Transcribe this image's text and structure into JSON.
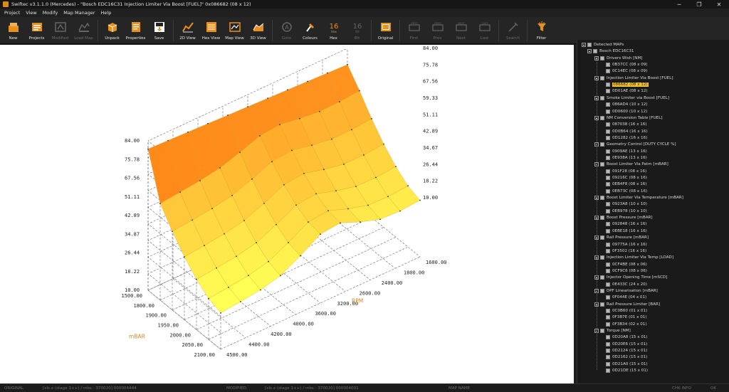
{
  "window": {
    "title": "Swiftec v3.1.1.0 (Mercedes) - \"Bosch EDC16C31 Injection Limiter Via Boost [FUEL]\" 0x086682 (08 x 12)",
    "minimize": "─",
    "maximize": "❐",
    "close": "✕"
  },
  "menu": [
    "Project",
    "View",
    "Modify",
    "Map Manager",
    "Help"
  ],
  "toolbar": [
    {
      "label": "New",
      "icon": "new-icon",
      "enabled": true
    },
    {
      "label": "Projects",
      "icon": "projects-icon",
      "enabled": true
    },
    {
      "label": "Modified",
      "icon": "modified-icon",
      "enabled": false
    },
    {
      "label": "Load Map",
      "icon": "load-map-icon",
      "enabled": false
    },
    {
      "label": "Unpack",
      "icon": "unpack-icon",
      "enabled": true
    },
    {
      "label": "Properties",
      "icon": "properties-icon",
      "enabled": true
    },
    {
      "label": "Save",
      "icon": "save-icon",
      "enabled": true
    },
    {
      "label": "2D View",
      "icon": "2d-view-icon",
      "enabled": true
    },
    {
      "label": "Hex View",
      "icon": "hex-view-icon",
      "enabled": true
    },
    {
      "label": "Map View",
      "icon": "map-view-icon",
      "enabled": true
    },
    {
      "label": "3D View",
      "icon": "3d-view-icon",
      "enabled": true
    },
    {
      "label": "Goto",
      "icon": "goto-icon",
      "enabled": false
    },
    {
      "label": "Colours",
      "icon": "colours-icon",
      "enabled": true
    },
    {
      "label": "Hex",
      "icon": "hex-icon",
      "enabled": true,
      "badge": "16"
    },
    {
      "label": "Bit",
      "icon": "bit-icon",
      "enabled": false,
      "badge": "16"
    },
    {
      "label": "Original",
      "icon": "original-icon",
      "enabled": true
    },
    {
      "label": "First",
      "icon": "first-icon",
      "enabled": false
    },
    {
      "label": "Prev",
      "icon": "prev-icon",
      "enabled": false
    },
    {
      "label": "Next",
      "icon": "next-icon",
      "enabled": false
    },
    {
      "label": "Last",
      "icon": "last-icon",
      "enabled": false
    },
    {
      "label": "Search",
      "icon": "search-icon",
      "enabled": false
    },
    {
      "label": "Filter",
      "icon": "filter-icon",
      "enabled": true
    }
  ],
  "colors": {
    "accent": "#e8901c",
    "surface_light": "#ffff55",
    "surface_dark": "#ff8a1a",
    "selected": "#f4c430"
  },
  "chart_data": {
    "type": "surface3d",
    "z_ticks": [
      "84.00",
      "75.78",
      "67.56",
      "59.33",
      "51.11",
      "42.89",
      "34.67",
      "26.44",
      "18.22",
      "10.00"
    ],
    "z_ticks_left": [
      "84.00",
      "75.78",
      "67.56",
      "51.11",
      "42.89",
      "34.87",
      "26.44",
      "18.22",
      "10.00"
    ],
    "x_axis": {
      "label": "RPM",
      "ticks": [
        "1600.00",
        "1800.00",
        "2400.00",
        "2600.00",
        "3200.00",
        "3600.00",
        "4000.00",
        "4200.00",
        "4400.00",
        "4500.00"
      ]
    },
    "y_axis": {
      "label": "mBAR",
      "ticks": [
        "1500.00",
        "1800.00",
        "1900.00",
        "1950.00",
        "2000.00",
        "2050.00",
        "2100.00"
      ]
    },
    "zlim": [
      10,
      84
    ]
  },
  "tree": {
    "root": "Detected MAPs",
    "ecu": "Bosch EDC16C31",
    "groups": [
      {
        "name": "Drivers Wish [NM]",
        "items": [
          "0B37CC (08 x 09)",
          "0C14EC (08 x 09)"
        ]
      },
      {
        "name": "Injection Limiter Via Boost [FUEL]",
        "items": [
          "086682 (08 x 12)",
          "0D01AE (08 x 12)"
        ],
        "selected": 0
      },
      {
        "name": "Smoke Limiter via Boost [FUEL]",
        "items": [
          "086AD4 (10 x 12)",
          "0D0600 (10 x 12)"
        ]
      },
      {
        "name": "NM Conversion Table [FUEL]",
        "items": [
          "087038 (16 x 16)",
          "0D0B64 (16 x 16)",
          "0D1282 (16 x 16)"
        ]
      },
      {
        "name": "Geometry Control [DUTY CYCLE %]",
        "items": [
          "0909AE (13 x 16)",
          "0E938A (13 x 16)"
        ]
      },
      {
        "name": "Boost Limiter Via Patm [mBAR]",
        "items": [
          "091F28 (08 x 16)",
          "09216C (08 x 16)",
          "0EB4F8 (08 x 16)",
          "0EB73C (08 x 16)"
        ]
      },
      {
        "name": "Boost Limiter Via Temperature [mBAR]",
        "items": [
          "0923A8 (10 x 10)",
          "0EB978 (10 x 10)"
        ]
      },
      {
        "name": "Boost Pressure [mBAR]",
        "items": [
          "092848 (16 x 16)",
          "0EBE18 (16 x 16)"
        ]
      },
      {
        "name": "Rail Pressure [mBAR]",
        "items": [
          "09775A (16 x 16)",
          "0F3502 (16 x 16)"
        ]
      },
      {
        "name": "Injection Limiter Via Temp [LOAD]",
        "items": [
          "0CF4BE (08 x 06)",
          "0CF9C6 (08 x 06)"
        ]
      },
      {
        "name": "Injector Opening Time [mSCD]",
        "items": [
          "0E433C (24 x 20)"
        ]
      },
      {
        "name": "DPF Linearisation [mBAR]",
        "items": [
          "0F044E (04 x 01)"
        ]
      },
      {
        "name": "Rail Pressure Limiter [BAR]",
        "items": [
          "0C0B60 (01 x 01)",
          "0F3B7E (01 x 01)",
          "0F3B34 (02 x 01)"
        ]
      },
      {
        "name": "Torque [NM]",
        "items": [
          "0D20A8 (15 x 01)",
          "0D20E6 (15 x 01)",
          "0D2124 (15 x 01)",
          "0D2162 (15 x 01)",
          "0D21A0 (15 x 01)",
          "0D21DE (15 x 01)"
        ]
      }
    ]
  },
  "status": {
    "c1": "ORIGINAL",
    "c2": "[xls x (stage 1++) / mbs - 370020] 000004444",
    "c3": "MODIFIED",
    "c4": "[xls x (stage 1++) / mbs - 370020] 000004001",
    "c5": "MAP NAME",
    "c6": "CHK INFO",
    "c7": "OK"
  }
}
